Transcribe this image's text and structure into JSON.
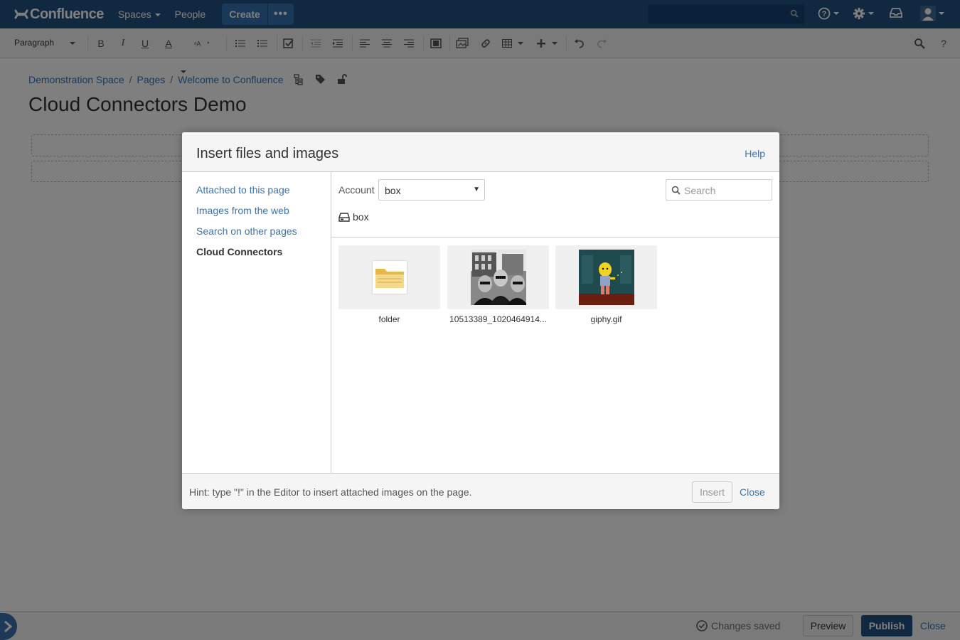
{
  "topnav": {
    "logo_text": "Confluence",
    "spaces_label": "Spaces",
    "people_label": "People",
    "create_label": "Create",
    "more_label": "•••",
    "search_placeholder": ""
  },
  "toolbar": {
    "paragraph_label": "Paragraph",
    "bold": "B",
    "italic": "I",
    "underline": "U",
    "text_color": "A"
  },
  "breadcrumb": {
    "items": [
      "Demonstration Space",
      "Pages",
      "Welcome to Confluence"
    ],
    "separator": "/"
  },
  "page": {
    "title": "Cloud Connectors Demo"
  },
  "dialog": {
    "title": "Insert files and images",
    "help_label": "Help",
    "nav": [
      {
        "label": "Attached to this page",
        "active": false
      },
      {
        "label": "Images from the web",
        "active": false
      },
      {
        "label": "Search on other pages",
        "active": false
      },
      {
        "label": "Cloud Connectors",
        "active": true
      }
    ],
    "account_label": "Account",
    "account_value": "box",
    "search_placeholder": "Search",
    "path_label": "box",
    "files": [
      {
        "name": "folder",
        "type": "folder"
      },
      {
        "name": "10513389_1020464914...",
        "type": "image"
      },
      {
        "name": "giphy.gif",
        "type": "gif"
      }
    ],
    "hint": "Hint: type \"!\" in the Editor to insert attached images on the page.",
    "insert_label": "Insert",
    "close_label": "Close"
  },
  "bottombar": {
    "status": "Changes saved",
    "preview_label": "Preview",
    "publish_label": "Publish",
    "close_label": "Close"
  },
  "colors": {
    "nav_bg": "#205081",
    "link": "#3b73af",
    "primary_button": "#205081"
  }
}
